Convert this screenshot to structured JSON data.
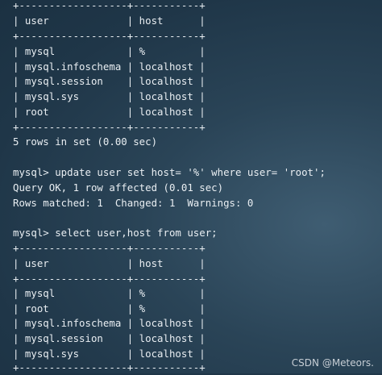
{
  "terminal": {
    "lines": [
      "+------------------+-----------+",
      "| user             | host      |",
      "+------------------+-----------+",
      "| mysql            | %         |",
      "| mysql.infoschema | localhost |",
      "| mysql.session    | localhost |",
      "| mysql.sys        | localhost |",
      "| root             | localhost |",
      "+------------------+-----------+",
      "5 rows in set (0.00 sec)",
      "",
      "mysql> update user set host= '%' where user= 'root';",
      "Query OK, 1 row affected (0.01 sec)",
      "Rows matched: 1  Changed: 1  Warnings: 0",
      "",
      "mysql> select user,host from user;",
      "+------------------+-----------+",
      "| user             | host      |",
      "+------------------+-----------+",
      "| mysql            | %         |",
      "| root             | %         |",
      "| mysql.infoschema | localhost |",
      "| mysql.session    | localhost |",
      "| mysql.sys        | localhost |",
      "+------------------+-----------+"
    ]
  },
  "watermark": "CSDN @Meteors."
}
